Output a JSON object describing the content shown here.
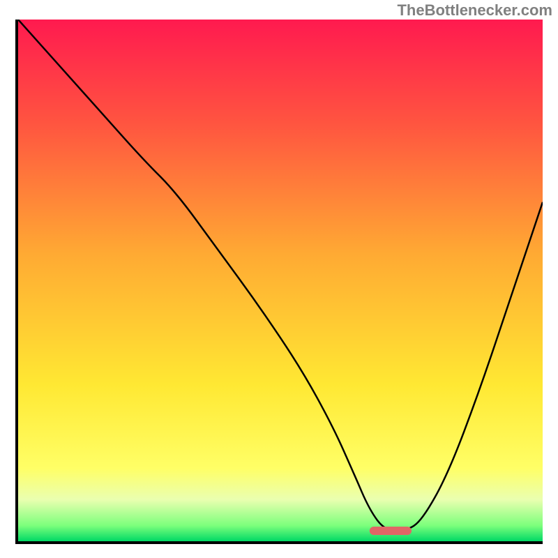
{
  "watermark": "TheBottlenecker.com",
  "chart_data": {
    "type": "line",
    "title": "",
    "xlabel": "",
    "ylabel": "",
    "xlim": [
      0,
      100
    ],
    "ylim": [
      0,
      100
    ],
    "grid": false,
    "background": {
      "type": "vertical-gradient",
      "stops": [
        {
          "pos": 0.0,
          "color": "#ff1a4f"
        },
        {
          "pos": 0.2,
          "color": "#ff5540"
        },
        {
          "pos": 0.45,
          "color": "#ffaa33"
        },
        {
          "pos": 0.7,
          "color": "#ffe833"
        },
        {
          "pos": 0.86,
          "color": "#ffff66"
        },
        {
          "pos": 0.92,
          "color": "#eaffb0"
        },
        {
          "pos": 0.97,
          "color": "#7cff7c"
        },
        {
          "pos": 1.0,
          "color": "#00d966"
        }
      ]
    },
    "series": [
      {
        "name": "curve",
        "x": [
          0,
          8,
          16,
          24,
          30,
          38,
          46,
          54,
          60,
          64,
          67,
          70,
          74,
          77,
          82,
          88,
          94,
          100
        ],
        "y": [
          100,
          91,
          82,
          73,
          67,
          56,
          45,
          33,
          22,
          13,
          6,
          2,
          2,
          4,
          13,
          29,
          47,
          65
        ]
      }
    ],
    "marker": {
      "name": "highlight-pill",
      "x_center": 71,
      "y": 2,
      "width": 8,
      "color": "#e06666"
    }
  }
}
